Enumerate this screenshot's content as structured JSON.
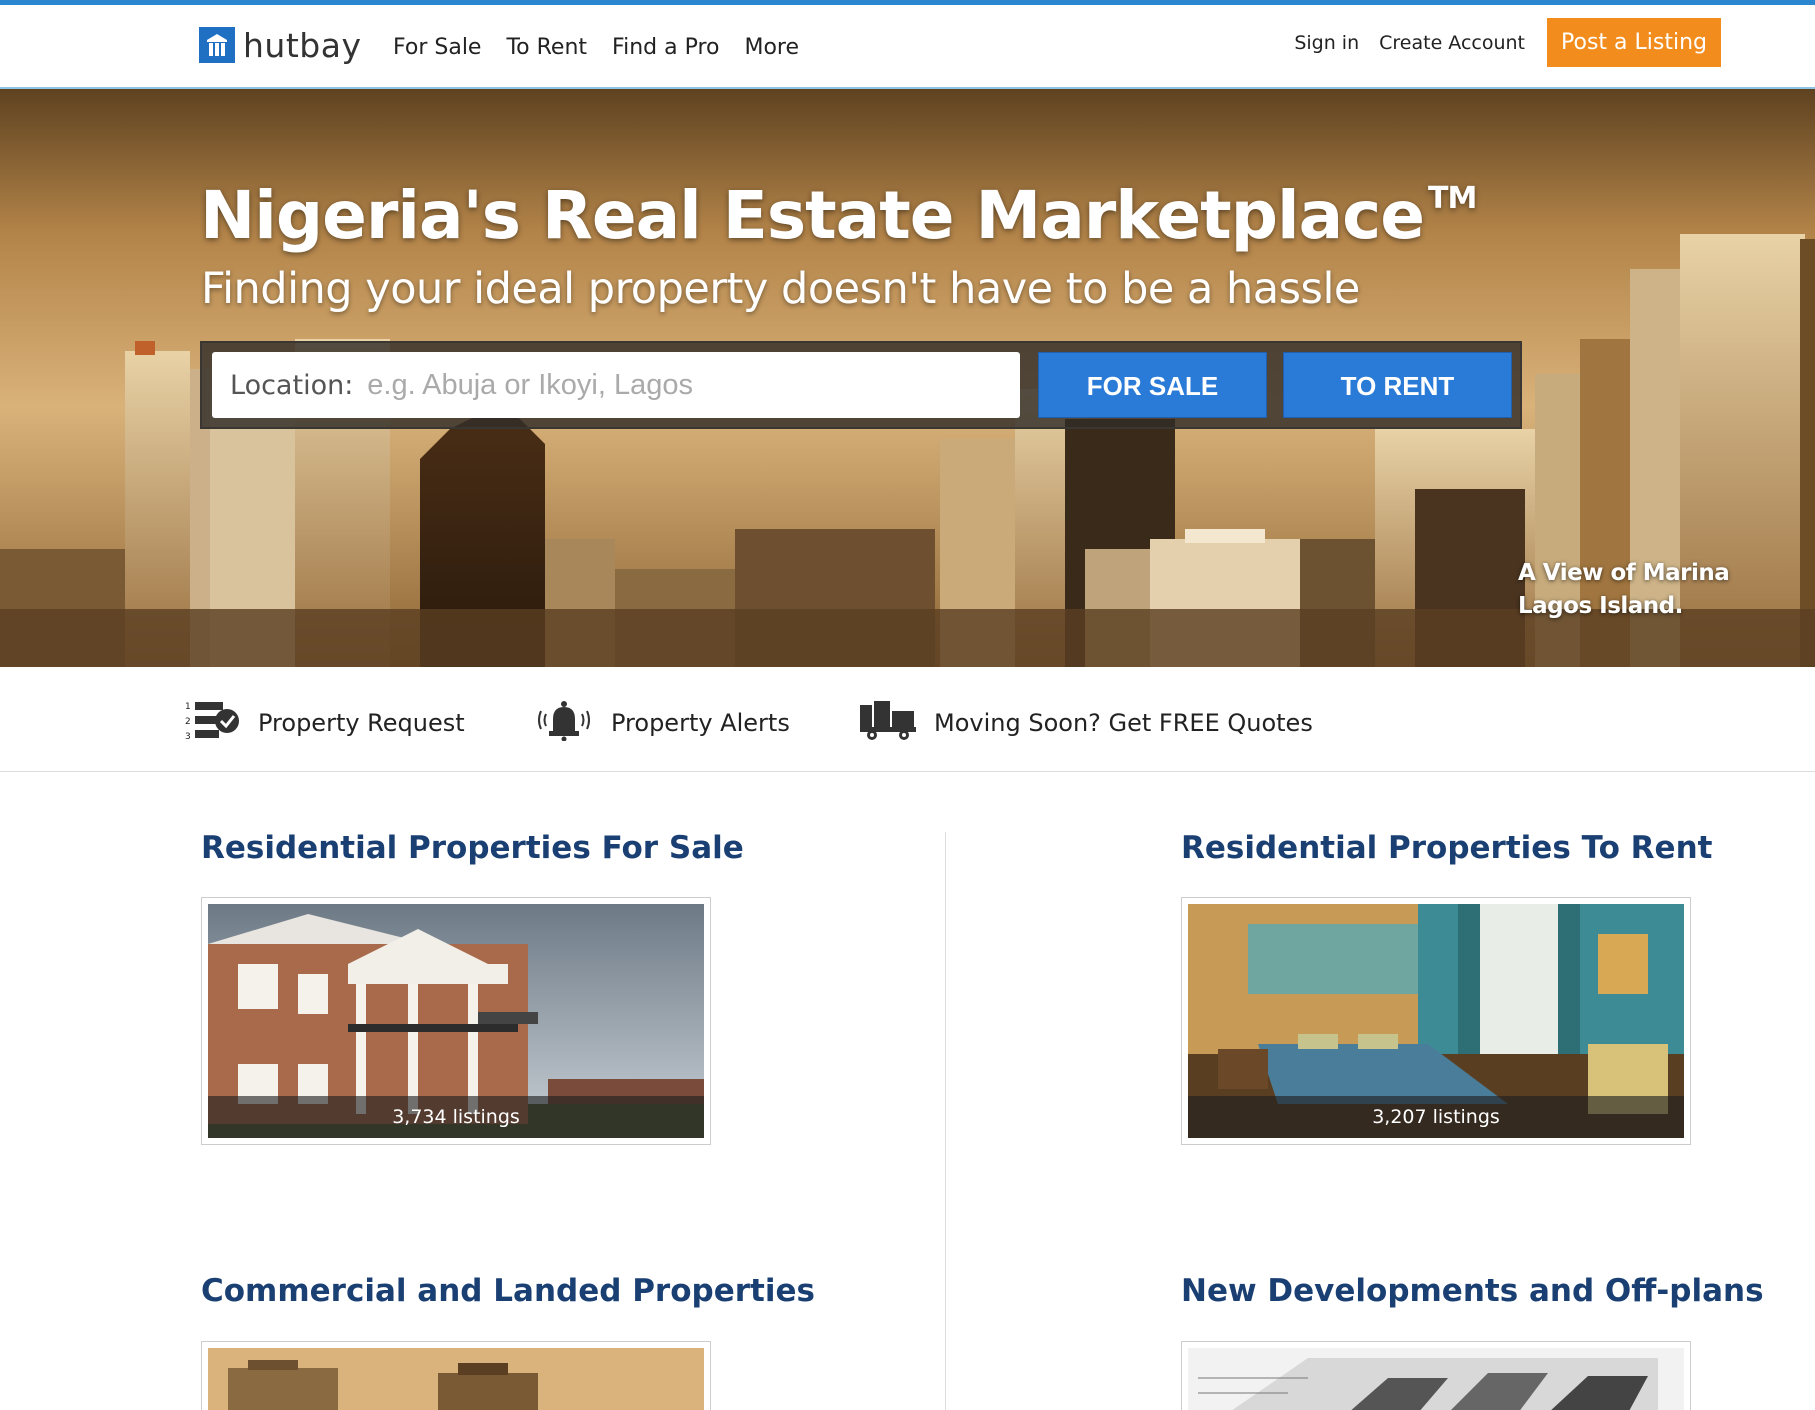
{
  "header": {
    "logo_text": "hutbay",
    "nav": [
      {
        "label": "For Sale"
      },
      {
        "label": "To Rent"
      },
      {
        "label": "Find a Pro"
      },
      {
        "label": "More"
      }
    ],
    "sign_in": "Sign in",
    "create_account": "Create Account",
    "post_listing": "Post a Listing"
  },
  "hero": {
    "title": "Nigeria's Real Estate Marketplace",
    "trademark": "TM",
    "subtitle": "Finding your ideal property doesn't have to be a hassle",
    "search": {
      "label": "Location:",
      "placeholder": "e.g. Abuja or Ikoyi, Lagos",
      "for_sale": "FOR SALE",
      "to_rent": "TO RENT"
    },
    "caption_line1": "A View of Marina",
    "caption_line2": "Lagos Island."
  },
  "quick_links": [
    {
      "label": "Property Request",
      "icon": "numbered-list-check-icon"
    },
    {
      "label": "Property Alerts",
      "icon": "bell-icon"
    },
    {
      "label": "Moving Soon? Get FREE Quotes",
      "icon": "truck-icon"
    }
  ],
  "sections": [
    {
      "title": "Residential Properties For Sale",
      "count": "3,734 listings"
    },
    {
      "title": "Residential Properties To Rent",
      "count": "3,207 listings"
    },
    {
      "title": "Commercial and Landed Properties",
      "count": ""
    },
    {
      "title": "New Developments and Off-plans",
      "count": ""
    }
  ],
  "colors": {
    "accent_blue": "#2a7ad8",
    "orange": "#f28c1c",
    "heading_blue": "#1a3f73"
  }
}
